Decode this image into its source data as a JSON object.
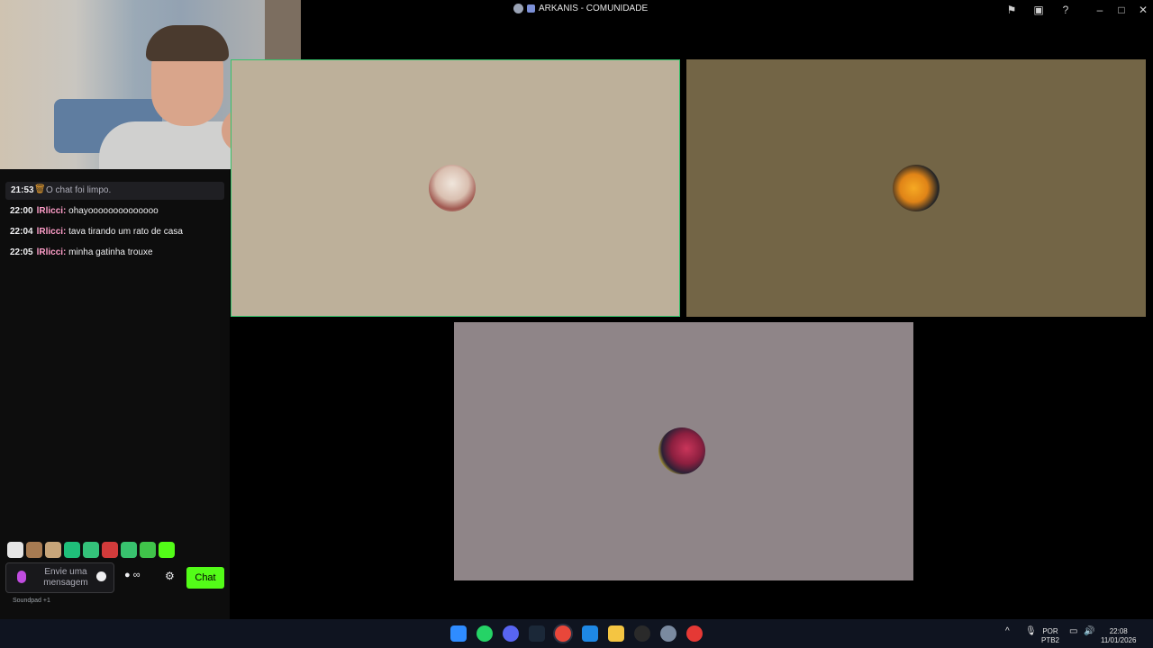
{
  "window": {
    "title": "ARKANIS - COMUNIDADE",
    "controls": [
      "flag-icon",
      "screen-share-icon",
      "help-icon",
      "minimize-icon",
      "maximize-icon",
      "close-icon"
    ]
  },
  "chat": {
    "system_message": {
      "time": "21:53",
      "text": "O chat foi limpo."
    },
    "messages": [
      {
        "time": "22:00",
        "user": "lRlicci:",
        "text": " ohayoooooooooooooo"
      },
      {
        "time": "22:04",
        "user": "lRlicci:",
        "text": " tava tirando um rato de casa"
      },
      {
        "time": "22:05",
        "user": "lRlicci:",
        "text": " minha gatinha trouxe"
      }
    ],
    "input_placeholder": "Envie uma mensagem",
    "points_label": "∞",
    "send_label": "Chat",
    "soundpad_label": "Soundpad +1",
    "accent_color": "#53fc18"
  },
  "taskbar": {
    "apps": [
      "windows-start-icon",
      "whatsapp-icon",
      "discord-icon",
      "steam-icon",
      "chrome-icon",
      "app-icon",
      "file-explorer-icon",
      "obs-icon",
      "settings-icon",
      "youtube-icon"
    ],
    "language": "POR",
    "layout": "PTB2",
    "time": "22:08",
    "date": "11/01/2026"
  }
}
